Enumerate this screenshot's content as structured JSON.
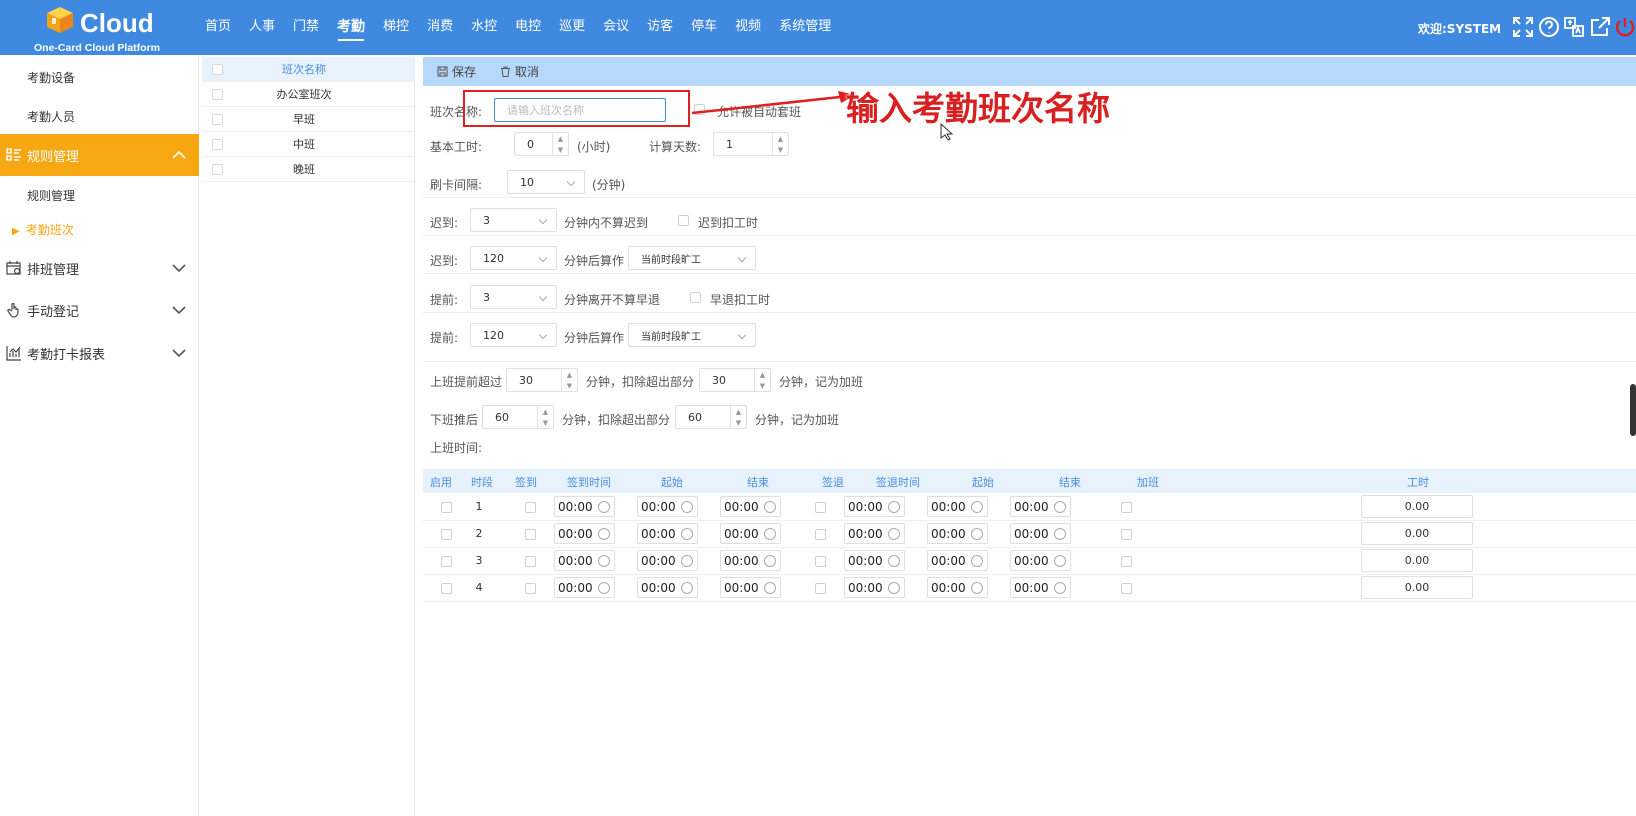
{
  "header": {
    "logo_text": "Cloud",
    "logo_subtitle": "One-Card Cloud Platform",
    "nav": [
      "首页",
      "人事",
      "门禁",
      "考勤",
      "梯控",
      "消费",
      "水控",
      "电控",
      "巡更",
      "会议",
      "访客",
      "停车",
      "视频",
      "系统管理"
    ],
    "active_nav_index": 3,
    "welcome": "欢迎:SYSTEM"
  },
  "sidebar": {
    "sub_items_top": [
      "考勤设备",
      "考勤人员"
    ],
    "group_rules": "规则管理",
    "rules_sub": "规则管理",
    "rules_active_sub": "考勤班次",
    "group_schedule": "排班管理",
    "group_manual": "手动登记",
    "group_report": "考勤打卡报表"
  },
  "shift_list": {
    "header": "班次名称",
    "items": [
      "办公室班次",
      "早班",
      "中班",
      "晚班"
    ]
  },
  "toolbar": {
    "save": "保存",
    "cancel": "取消"
  },
  "form": {
    "name_label": "班次名称:",
    "name_placeholder": "请输入班次名称",
    "allow_auto": "允许被自动套班",
    "base_hours_label": "基本工时:",
    "base_hours_value": "0",
    "hours_unit": "(小时)",
    "calc_days_label": "计算天数:",
    "calc_days_value": "1",
    "swipe_interval_label": "刷卡间隔:",
    "swipe_interval_value": "10",
    "minutes_unit": "(分钟)",
    "late_label": "迟到:",
    "late_grace_value": "3",
    "late_grace_text": "分钟内不算迟到",
    "late_deduct_text": "迟到扣工时",
    "late_after_value": "120",
    "after_calc_text": "分钟后算作",
    "late_after_select": "当前时段旷工",
    "early_label": "提前:",
    "early_grace_value": "3",
    "early_grace_text": "分钟离开不算早退",
    "early_deduct_text": "早退扣工时",
    "early_after_value": "120",
    "early_after_select": "当前时段旷工",
    "ot_before_label": "上班提前超过",
    "ot_before_value": "30",
    "ot_minus_text": "分钟，扣除超出部分",
    "ot_before_deduct": "30",
    "ot_suffix": "分钟，记为加班",
    "ot_after_label": "下班推后",
    "ot_after_value": "60",
    "ot_after_deduct": "60",
    "work_time_label": "上班时间:"
  },
  "annotation": "输入考勤班次名称",
  "time_table": {
    "headers": [
      "启用",
      "时段",
      "签到",
      "签到时间",
      "起始",
      "结束",
      "签退",
      "签退时间",
      "起始",
      "结束",
      "加班",
      "工时"
    ],
    "rows": [
      {
        "no": "1",
        "t1": "00:00",
        "t2": "00:00",
        "t3": "00:00",
        "t4": "00:00",
        "t5": "00:00",
        "t6": "00:00",
        "hours": "0.00"
      },
      {
        "no": "2",
        "t1": "00:00",
        "t2": "00:00",
        "t3": "00:00",
        "t4": "00:00",
        "t5": "00:00",
        "t6": "00:00",
        "hours": "0.00"
      },
      {
        "no": "3",
        "t1": "00:00",
        "t2": "00:00",
        "t3": "00:00",
        "t4": "00:00",
        "t5": "00:00",
        "t6": "00:00",
        "hours": "0.00"
      },
      {
        "no": "4",
        "t1": "00:00",
        "t2": "00:00",
        "t3": "00:00",
        "t4": "00:00",
        "t5": "00:00",
        "t6": "00:00",
        "hours": "0.00"
      }
    ]
  },
  "colors": {
    "primary": "#3f8ae0",
    "accent": "#f7a711",
    "annotation": "#d92020"
  }
}
